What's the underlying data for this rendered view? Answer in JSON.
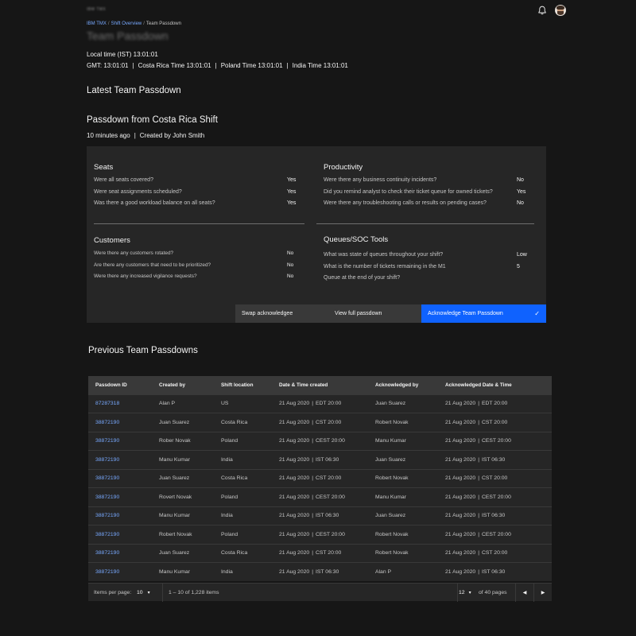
{
  "header": {
    "brand": "IBM TMX",
    "notifications_icon": "bell-icon",
    "avatar": "user-avatar"
  },
  "breadcrumb": {
    "items": [
      "IBM TMX",
      "Shift Overview",
      "Team Passdown"
    ],
    "separator": "/"
  },
  "page_title": "Team Passdown",
  "times": {
    "local": "Local time (IST) 13:01:01",
    "zones": [
      "GMT: 13:01:01",
      "Costa Rica Time 13:01:01",
      "Poland Time 13:01:01",
      "India Time 13:01:01"
    ],
    "separator": "|"
  },
  "latest": {
    "heading": "Latest Team Passdown",
    "passdown_title": "Passdown from Costa Rica Shift",
    "age": "10 minutes ago",
    "created_by": "Created by John Smith",
    "sections": {
      "seats": {
        "title": "Seats",
        "rows": [
          {
            "q": "Were all seats covered?",
            "a": "Yes"
          },
          {
            "q": "Were seat assignments scheduled?",
            "a": "Yes"
          },
          {
            "q": "Was there a good workload balance on all seats?",
            "a": "Yes"
          }
        ]
      },
      "productivity": {
        "title": "Productivity",
        "rows": [
          {
            "q": "Were there any business continuity incidents?",
            "a": "No"
          },
          {
            "q": "Did you remind analyst to check their ticket queue for owned tickets?",
            "a": "Yes"
          },
          {
            "q": "Were there any troubleshooting calls or results on pending cases?",
            "a": "No"
          }
        ]
      },
      "customers": {
        "title": "Customers",
        "rows": [
          {
            "q": "Were there any customers rotated?",
            "a": "No"
          },
          {
            "q": "Are there any customers that need to be prioritized?",
            "a": "No"
          },
          {
            "q": "Were there any increased vigilance requests?",
            "a": "No"
          }
        ]
      },
      "queues": {
        "title": "Queues/SOC Tools",
        "rows": [
          {
            "q": "What was state of queues throughout your shift?",
            "a": "Low"
          },
          {
            "q": "What is the number of tickets remaining in the M1",
            "a": "5"
          },
          {
            "q": "Queue at the end of your shift?",
            "a": ""
          }
        ]
      }
    },
    "actions": {
      "swap": "Swap acknowledgee",
      "view": "View full passdown",
      "acknowledge": "Acknowledge Team Passdown",
      "acknowledge_icon": "checkmark-icon"
    }
  },
  "previous": {
    "heading": "Previous Team Passdowns",
    "columns": [
      "Passdown ID",
      "Created by",
      "Shift location",
      "Date & Time created",
      "Acknowledged by",
      "Acknowledged Date & Time"
    ],
    "rows": [
      {
        "id": "87287318",
        "created_by": "Alan P",
        "location": "US",
        "created_date": "21 Aug 2020",
        "created_time": "EDT 20:00",
        "ack_by": "Juan Suarez",
        "ack_date": "21 Aug 2020",
        "ack_time": "EDT 20:00"
      },
      {
        "id": "38872190",
        "created_by": "Juan Suarez",
        "location": "Costa Rica",
        "created_date": "21 Aug 2020",
        "created_time": "CST 20:00",
        "ack_by": "Robert Novak",
        "ack_date": "21 Aug 2020",
        "ack_time": "CST 20:00"
      },
      {
        "id": "38872190",
        "created_by": "Rober Novak",
        "location": "Poland",
        "created_date": "21 Aug 2020",
        "created_time": "CEST 20:00",
        "ack_by": "Manu Kumar",
        "ack_date": "21 Aug 2020",
        "ack_time": "CEST 20:00"
      },
      {
        "id": "38872190",
        "created_by": "Manu Kumar",
        "location": "India",
        "created_date": "21 Aug 2020",
        "created_time": "IST 06:30",
        "ack_by": "Juan Suarez",
        "ack_date": "21 Aug 2020",
        "ack_time": "IST 06:30"
      },
      {
        "id": "38872190",
        "created_by": "Juan Suarez",
        "location": "Costa Rica",
        "created_date": "21 Aug 2020",
        "created_time": "CST 20:00",
        "ack_by": "Robert Novak",
        "ack_date": "21 Aug 2020",
        "ack_time": "CST 20:00"
      },
      {
        "id": "38872190",
        "created_by": "Rovert Novak",
        "location": "Poland",
        "created_date": "21 Aug 2020",
        "created_time": "CEST 20:00",
        "ack_by": "Manu Kumar",
        "ack_date": "21 Aug 2020",
        "ack_time": "CEST 20:00"
      },
      {
        "id": "38872190",
        "created_by": "Manu Kumar",
        "location": "India",
        "created_date": "21 Aug 2020",
        "created_time": "IST 06:30",
        "ack_by": "Juan Suarez",
        "ack_date": "21 Aug 2020",
        "ack_time": "IST 06:30"
      },
      {
        "id": "38872190",
        "created_by": "Robert Novak",
        "location": "Poland",
        "created_date": "21 Aug 2020",
        "created_time": "CEST 20:00",
        "ack_by": "Robert Novak",
        "ack_date": "21 Aug 2020",
        "ack_time": "CEST 20:00"
      },
      {
        "id": "38872190",
        "created_by": "Juan Suarez",
        "location": "Costa Rica",
        "created_date": "21 Aug 2020",
        "created_time": "CST 20:00",
        "ack_by": "Robert Novak",
        "ack_date": "21 Aug 2020",
        "ack_time": "CST 20:00"
      },
      {
        "id": "38872190",
        "created_by": "Manu Kumar",
        "location": "India",
        "created_date": "21 Aug 2020",
        "created_time": "IST 06:30",
        "ack_by": "Alan P",
        "ack_date": "21 Aug 2020",
        "ack_time": "IST 06:30"
      }
    ],
    "pagination": {
      "items_per_page_label": "Items per page:",
      "items_per_page": "10",
      "range": "1 – 10 of 1,228 items",
      "page": "12",
      "of_pages": "of 40 pages",
      "prev_icon": "caret-left-icon",
      "next_icon": "caret-right-icon"
    }
  },
  "colors": {
    "background": "#161616",
    "surface": "#262626",
    "accent": "#0f62fe",
    "link": "#78a9ff"
  }
}
